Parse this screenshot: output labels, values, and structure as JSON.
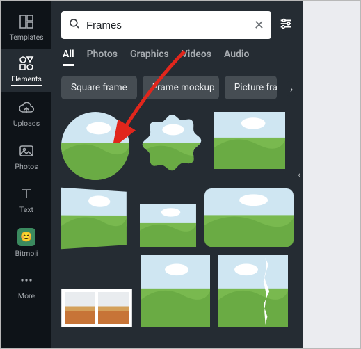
{
  "rail": {
    "items": [
      {
        "label": "Templates"
      },
      {
        "label": "Elements"
      },
      {
        "label": "Uploads"
      },
      {
        "label": "Photos"
      },
      {
        "label": "Text"
      },
      {
        "label": "Bitmoji"
      },
      {
        "label": "More"
      }
    ]
  },
  "search": {
    "value": "Frames",
    "placeholder": "Search"
  },
  "tabs": [
    {
      "label": "All"
    },
    {
      "label": "Photos"
    },
    {
      "label": "Graphics"
    },
    {
      "label": "Videos"
    },
    {
      "label": "Audio"
    }
  ],
  "pills": [
    {
      "label": "Square frame"
    },
    {
      "label": "Frame mockup"
    },
    {
      "label": "Picture frame"
    }
  ],
  "frames": {
    "circle": "circle-frame",
    "burst": "burst-frame",
    "rect": "rect-frame",
    "skewed": "skewed-frame",
    "wide": "wide-frame",
    "rounded": "rounded-frame",
    "film": "filmstrip-frame",
    "tall": "tall-frame",
    "crack": "cracked-frame"
  }
}
